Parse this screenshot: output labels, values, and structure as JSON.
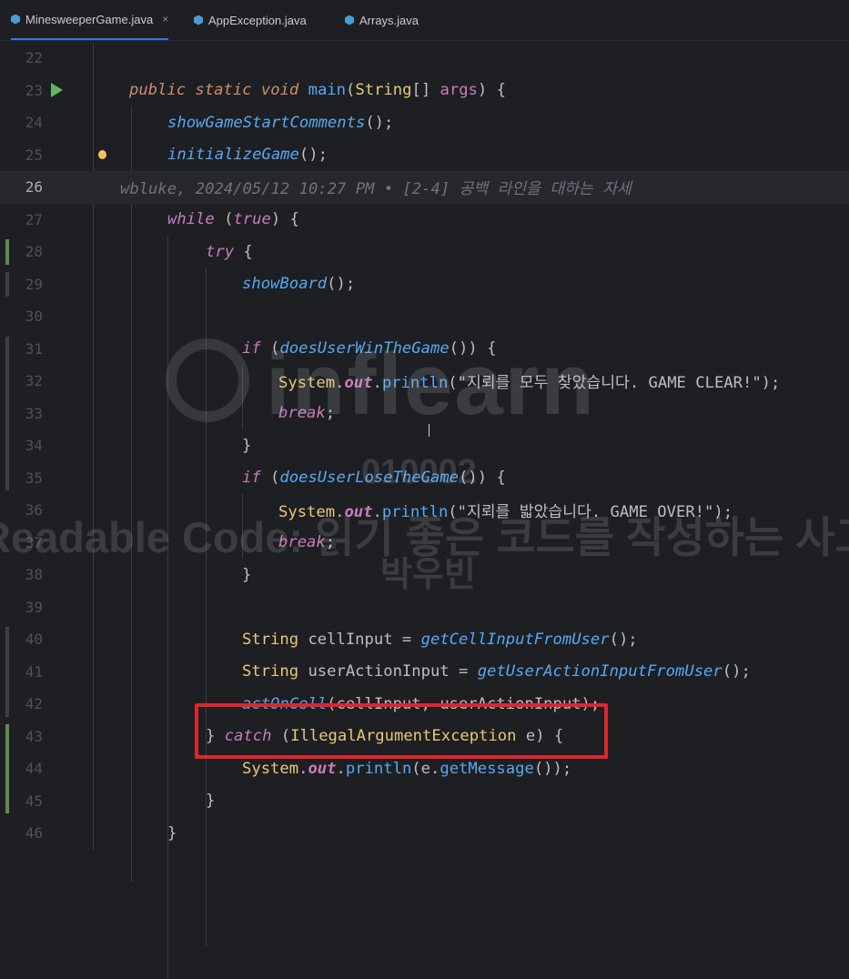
{
  "tabs": [
    {
      "label": "MinesweeperGame.java",
      "active": true,
      "close": "×"
    },
    {
      "label": "AppException.java",
      "active": false
    },
    {
      "label": "Arrays.java",
      "active": false
    }
  ],
  "current_line": 26,
  "lines": [
    {
      "n": 22,
      "segs": []
    },
    {
      "n": 23,
      "segs": [
        [
          "kwi",
          "public static void "
        ],
        [
          "fnp",
          "main"
        ],
        [
          "plain",
          "("
        ],
        [
          "type",
          "String"
        ],
        [
          "plain",
          "[] "
        ],
        [
          "param",
          "args"
        ],
        [
          "plain",
          ") {"
        ]
      ]
    },
    {
      "n": 24,
      "segs": [
        [
          "fn",
          "showGameStartComments"
        ],
        [
          "plain",
          "();"
        ]
      ]
    },
    {
      "n": 25,
      "segs": [
        [
          "fn",
          "initializeGame"
        ],
        [
          "plain",
          "();"
        ]
      ]
    },
    {
      "n": 26,
      "segs": [
        [
          "blame",
          "wbluke, 2024/05/12 10:27 PM • [2-4] 공백 라인을 대하는 자세"
        ]
      ]
    },
    {
      "n": 27,
      "segs": [
        [
          "kwp",
          "while "
        ],
        [
          "plain",
          "("
        ],
        [
          "kwp",
          "true"
        ],
        [
          "plain",
          ") {"
        ]
      ]
    },
    {
      "n": 28,
      "segs": [
        [
          "kwp",
          "try "
        ],
        [
          "plain",
          "{"
        ]
      ]
    },
    {
      "n": 29,
      "segs": [
        [
          "fn",
          "showBoard"
        ],
        [
          "plain",
          "();"
        ]
      ]
    },
    {
      "n": 30,
      "segs": []
    },
    {
      "n": 31,
      "segs": [
        [
          "kwp",
          "if "
        ],
        [
          "plain",
          "("
        ],
        [
          "fn",
          "doesUserWinTheGame"
        ],
        [
          "plain",
          "()) {"
        ]
      ]
    },
    {
      "n": 32,
      "segs": [
        [
          "type",
          "System"
        ],
        [
          "plain",
          "."
        ],
        [
          "fld",
          "out"
        ],
        [
          "plain",
          "."
        ],
        [
          "fnp",
          "println"
        ],
        [
          "plain",
          "(\"지뢰를 모두 찾았습니다. GAME CLEAR!\");"
        ]
      ]
    },
    {
      "n": 33,
      "segs": [
        [
          "kwp",
          "break"
        ],
        [
          "plain",
          ";"
        ]
      ]
    },
    {
      "n": 34,
      "segs": [
        [
          "plain",
          "}"
        ]
      ]
    },
    {
      "n": 35,
      "segs": [
        [
          "kwp",
          "if "
        ],
        [
          "plain",
          "("
        ],
        [
          "fn",
          "doesUserLoseTheGame"
        ],
        [
          "plain",
          "()) {"
        ]
      ]
    },
    {
      "n": 36,
      "segs": [
        [
          "type",
          "System"
        ],
        [
          "plain",
          "."
        ],
        [
          "fld",
          "out"
        ],
        [
          "plain",
          "."
        ],
        [
          "fnp",
          "println"
        ],
        [
          "plain",
          "(\"지뢰를 밟았습니다. GAME OVER!\");"
        ]
      ]
    },
    {
      "n": 37,
      "segs": [
        [
          "kwp",
          "break"
        ],
        [
          "plain",
          ";"
        ]
      ]
    },
    {
      "n": 38,
      "segs": [
        [
          "plain",
          "}"
        ]
      ]
    },
    {
      "n": 39,
      "segs": []
    },
    {
      "n": 40,
      "segs": [
        [
          "type",
          "String "
        ],
        [
          "plain",
          "cellInput = "
        ],
        [
          "fn",
          "getCellInputFromUser"
        ],
        [
          "plain",
          "();"
        ]
      ]
    },
    {
      "n": 41,
      "segs": [
        [
          "type",
          "String "
        ],
        [
          "plain",
          "userActionInput = "
        ],
        [
          "fn",
          "getUserActionInputFromUser"
        ],
        [
          "plain",
          "();"
        ]
      ]
    },
    {
      "n": 42,
      "segs": [
        [
          "fn",
          "actOnCell"
        ],
        [
          "plain",
          "(cellInput, userActionInput);"
        ]
      ]
    },
    {
      "n": 43,
      "segs": [
        [
          "plain",
          "} "
        ],
        [
          "kwp",
          "catch "
        ],
        [
          "plain",
          "("
        ],
        [
          "type",
          "IllegalArgumentException "
        ],
        [
          "plain",
          "e) {"
        ]
      ]
    },
    {
      "n": 44,
      "segs": [
        [
          "type",
          "System"
        ],
        [
          "plain",
          "."
        ],
        [
          "fld",
          "out"
        ],
        [
          "plain",
          "."
        ],
        [
          "fnp",
          "println"
        ],
        [
          "plain",
          "(e."
        ],
        [
          "fnp",
          "getMessage"
        ],
        [
          "plain",
          "());"
        ]
      ]
    },
    {
      "n": 45,
      "segs": [
        [
          "plain",
          "}"
        ]
      ]
    },
    {
      "n": 46,
      "segs": [
        [
          "plain",
          "}"
        ]
      ]
    }
  ],
  "watermark": {
    "brand": "inflearn",
    "code": "010002",
    "course": "Readable Code: 읽기 좋은 코드를 작성하는 사고",
    "author": "박우빈"
  },
  "icons": {
    "run": "run-gutter-icon",
    "bulb": "intention-bulb-icon",
    "file": "java-class-icon"
  }
}
